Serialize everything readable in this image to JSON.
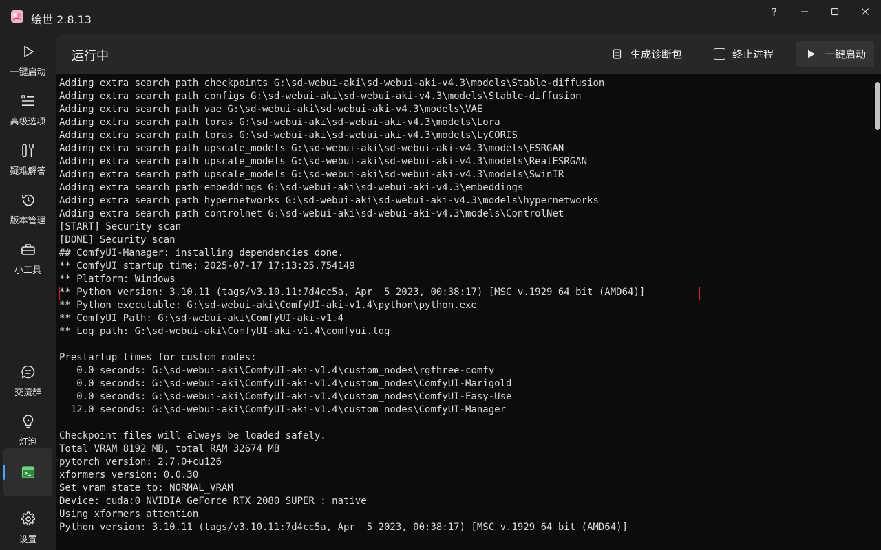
{
  "app": {
    "title": "绘世 2.8.13",
    "icon": "app-logo-icon"
  },
  "window_controls": {
    "help": "?",
    "icons": [
      "help-icon",
      "minimize-icon",
      "maximize-icon",
      "close-icon"
    ]
  },
  "sidebar": {
    "items": [
      {
        "label": "一键启动",
        "icon": "play-icon"
      },
      {
        "label": "高级选项",
        "icon": "list-icon"
      },
      {
        "label": "疑难解答",
        "icon": "tools-icon"
      },
      {
        "label": "版本管理",
        "icon": "history-icon"
      },
      {
        "label": "小工具",
        "icon": "toolbox-icon"
      },
      {
        "label": "交流群",
        "icon": "chat-icon"
      },
      {
        "label": "灯泡",
        "icon": "lightbulb-icon"
      },
      {
        "label": "",
        "icon": "terminal-icon",
        "active": true
      },
      {
        "label": "设置",
        "icon": "gear-icon"
      }
    ]
  },
  "header": {
    "title": "运行中",
    "diagnostics_label": "生成诊断包",
    "terminate_label": "终止进程",
    "launch_label": "一键启动"
  },
  "colors": {
    "accent": "#4aa3ff",
    "highlight_border": "#d02020",
    "console_bg": "#0c0c0c"
  },
  "console": {
    "highlighted_line_index": 16,
    "lines": [
      "Adding extra search path checkpoints G:\\sd-webui-aki\\sd-webui-aki-v4.3\\models\\Stable-diffusion",
      "Adding extra search path configs G:\\sd-webui-aki\\sd-webui-aki-v4.3\\models\\Stable-diffusion",
      "Adding extra search path vae G:\\sd-webui-aki\\sd-webui-aki-v4.3\\models\\VAE",
      "Adding extra search path loras G:\\sd-webui-aki\\sd-webui-aki-v4.3\\models\\Lora",
      "Adding extra search path loras G:\\sd-webui-aki\\sd-webui-aki-v4.3\\models\\LyCORIS",
      "Adding extra search path upscale_models G:\\sd-webui-aki\\sd-webui-aki-v4.3\\models\\ESRGAN",
      "Adding extra search path upscale_models G:\\sd-webui-aki\\sd-webui-aki-v4.3\\models\\RealESRGAN",
      "Adding extra search path upscale_models G:\\sd-webui-aki\\sd-webui-aki-v4.3\\models\\SwinIR",
      "Adding extra search path embeddings G:\\sd-webui-aki\\sd-webui-aki-v4.3\\embeddings",
      "Adding extra search path hypernetworks G:\\sd-webui-aki\\sd-webui-aki-v4.3\\models\\hypernetworks",
      "Adding extra search path controlnet G:\\sd-webui-aki\\sd-webui-aki-v4.3\\models\\ControlNet",
      "[START] Security scan",
      "[DONE] Security scan",
      "## ComfyUI-Manager: installing dependencies done.",
      "** ComfyUI startup time: 2025-07-17 17:13:25.754149",
      "** Platform: Windows",
      "** Python version: 3.10.11 (tags/v3.10.11:7d4cc5a, Apr  5 2023, 00:38:17) [MSC v.1929 64 bit (AMD64)]",
      "** Python executable: G:\\sd-webui-aki\\ComfyUI-aki-v1.4\\python\\python.exe",
      "** ComfyUI Path: G:\\sd-webui-aki\\ComfyUI-aki-v1.4",
      "** Log path: G:\\sd-webui-aki\\ComfyUI-aki-v1.4\\comfyui.log",
      "",
      "Prestartup times for custom nodes:",
      "   0.0 seconds: G:\\sd-webui-aki\\ComfyUI-aki-v1.4\\custom_nodes\\rgthree-comfy",
      "   0.0 seconds: G:\\sd-webui-aki\\ComfyUI-aki-v1.4\\custom_nodes\\ComfyUI-Marigold",
      "   0.0 seconds: G:\\sd-webui-aki\\ComfyUI-aki-v1.4\\custom_nodes\\ComfyUI-Easy-Use",
      "  12.0 seconds: G:\\sd-webui-aki\\ComfyUI-aki-v1.4\\custom_nodes\\ComfyUI-Manager",
      "",
      "Checkpoint files will always be loaded safely.",
      "Total VRAM 8192 MB, total RAM 32674 MB",
      "pytorch version: 2.7.0+cu126",
      "xformers version: 0.0.30",
      "Set vram state to: NORMAL_VRAM",
      "Device: cuda:0 NVIDIA GeForce RTX 2080 SUPER : native",
      "Using xformers attention",
      "Python version: 3.10.11 (tags/v3.10.11:7d4cc5a, Apr  5 2023, 00:38:17) [MSC v.1929 64 bit (AMD64)]"
    ]
  }
}
